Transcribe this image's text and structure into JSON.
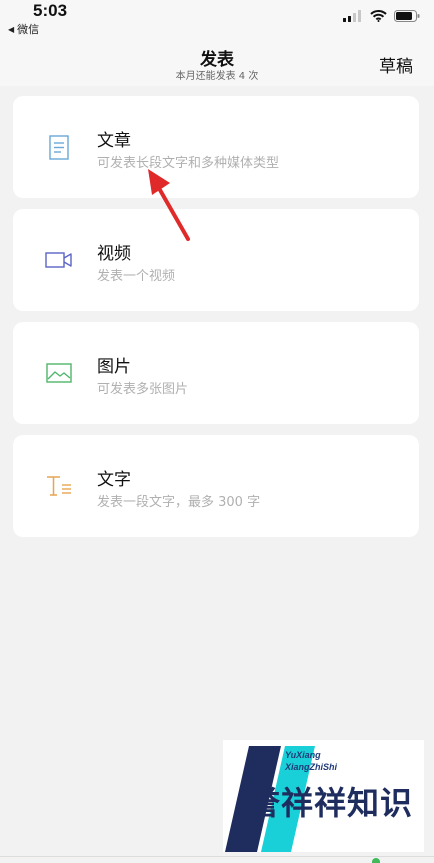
{
  "status_bar": {
    "time": "5:03",
    "back_app": "微信",
    "back_icon": "back-triangle-icon",
    "icons": [
      "signal-icon",
      "wifi-icon",
      "battery-icon"
    ]
  },
  "header": {
    "title": "发表",
    "subtitle": "本月还能发表 4 次",
    "draft_label": "草稿"
  },
  "options": [
    {
      "title": "文章",
      "description": "可发表长段文字和多种媒体类型",
      "icon": "article-icon",
      "icon_color": "#6aa7d8"
    },
    {
      "title": "视频",
      "description": "发表一个视频",
      "icon": "video-icon",
      "icon_color": "#5b64c6"
    },
    {
      "title": "图片",
      "description": "可发表多张图片",
      "icon": "image-icon",
      "icon_color": "#4fb56a"
    },
    {
      "title": "文字",
      "description": "发表一段文字，最多 300 字",
      "icon": "text-icon",
      "icon_color": "#e6a550"
    }
  ],
  "annotation": {
    "icon": "red-arrow-icon",
    "color": "#e02a2a"
  },
  "watermark": {
    "line1": "YuXiang",
    "line2": "XiangZhiShi",
    "brand": "誉祥祥知识",
    "colors": {
      "navy": "#1e2d5e",
      "cyan": "#1ad0d8"
    }
  }
}
